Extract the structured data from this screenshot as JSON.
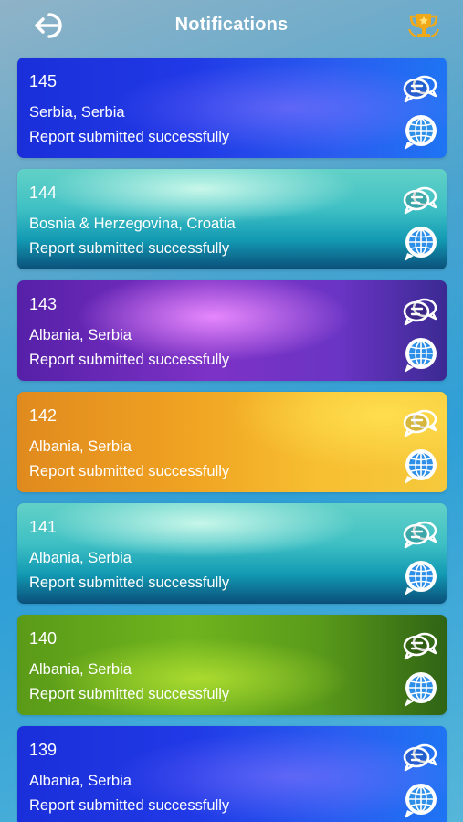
{
  "header": {
    "title": "Notifications",
    "back_icon": "logout-arrow-icon",
    "trophy_icon": "trophy-icon",
    "trophy_color": "#f2a918"
  },
  "notifications": [
    {
      "id": "145",
      "location": "Serbia, Serbia",
      "message": "Report submitted successfully",
      "theme": "blue"
    },
    {
      "id": "144",
      "location": "Bosnia & Herzegovina, Croatia",
      "message": "Report submitted successfully",
      "theme": "teal"
    },
    {
      "id": "143",
      "location": "Albania, Serbia",
      "message": "Report submitted successfully",
      "theme": "purple"
    },
    {
      "id": "142",
      "location": "Albania, Serbia",
      "message": "Report submitted successfully",
      "theme": "orange"
    },
    {
      "id": "141",
      "location": "Albania, Serbia",
      "message": "Report submitted successfully",
      "theme": "teal"
    },
    {
      "id": "140",
      "location": "Albania, Serbia",
      "message": "Report submitted successfully",
      "theme": "green"
    },
    {
      "id": "139",
      "location": "Albania, Serbia",
      "message": "Report submitted successfully",
      "theme": "blue"
    }
  ],
  "card_icons": {
    "chat": "chat-bubbles-icon",
    "globe": "globe-speech-icon"
  }
}
